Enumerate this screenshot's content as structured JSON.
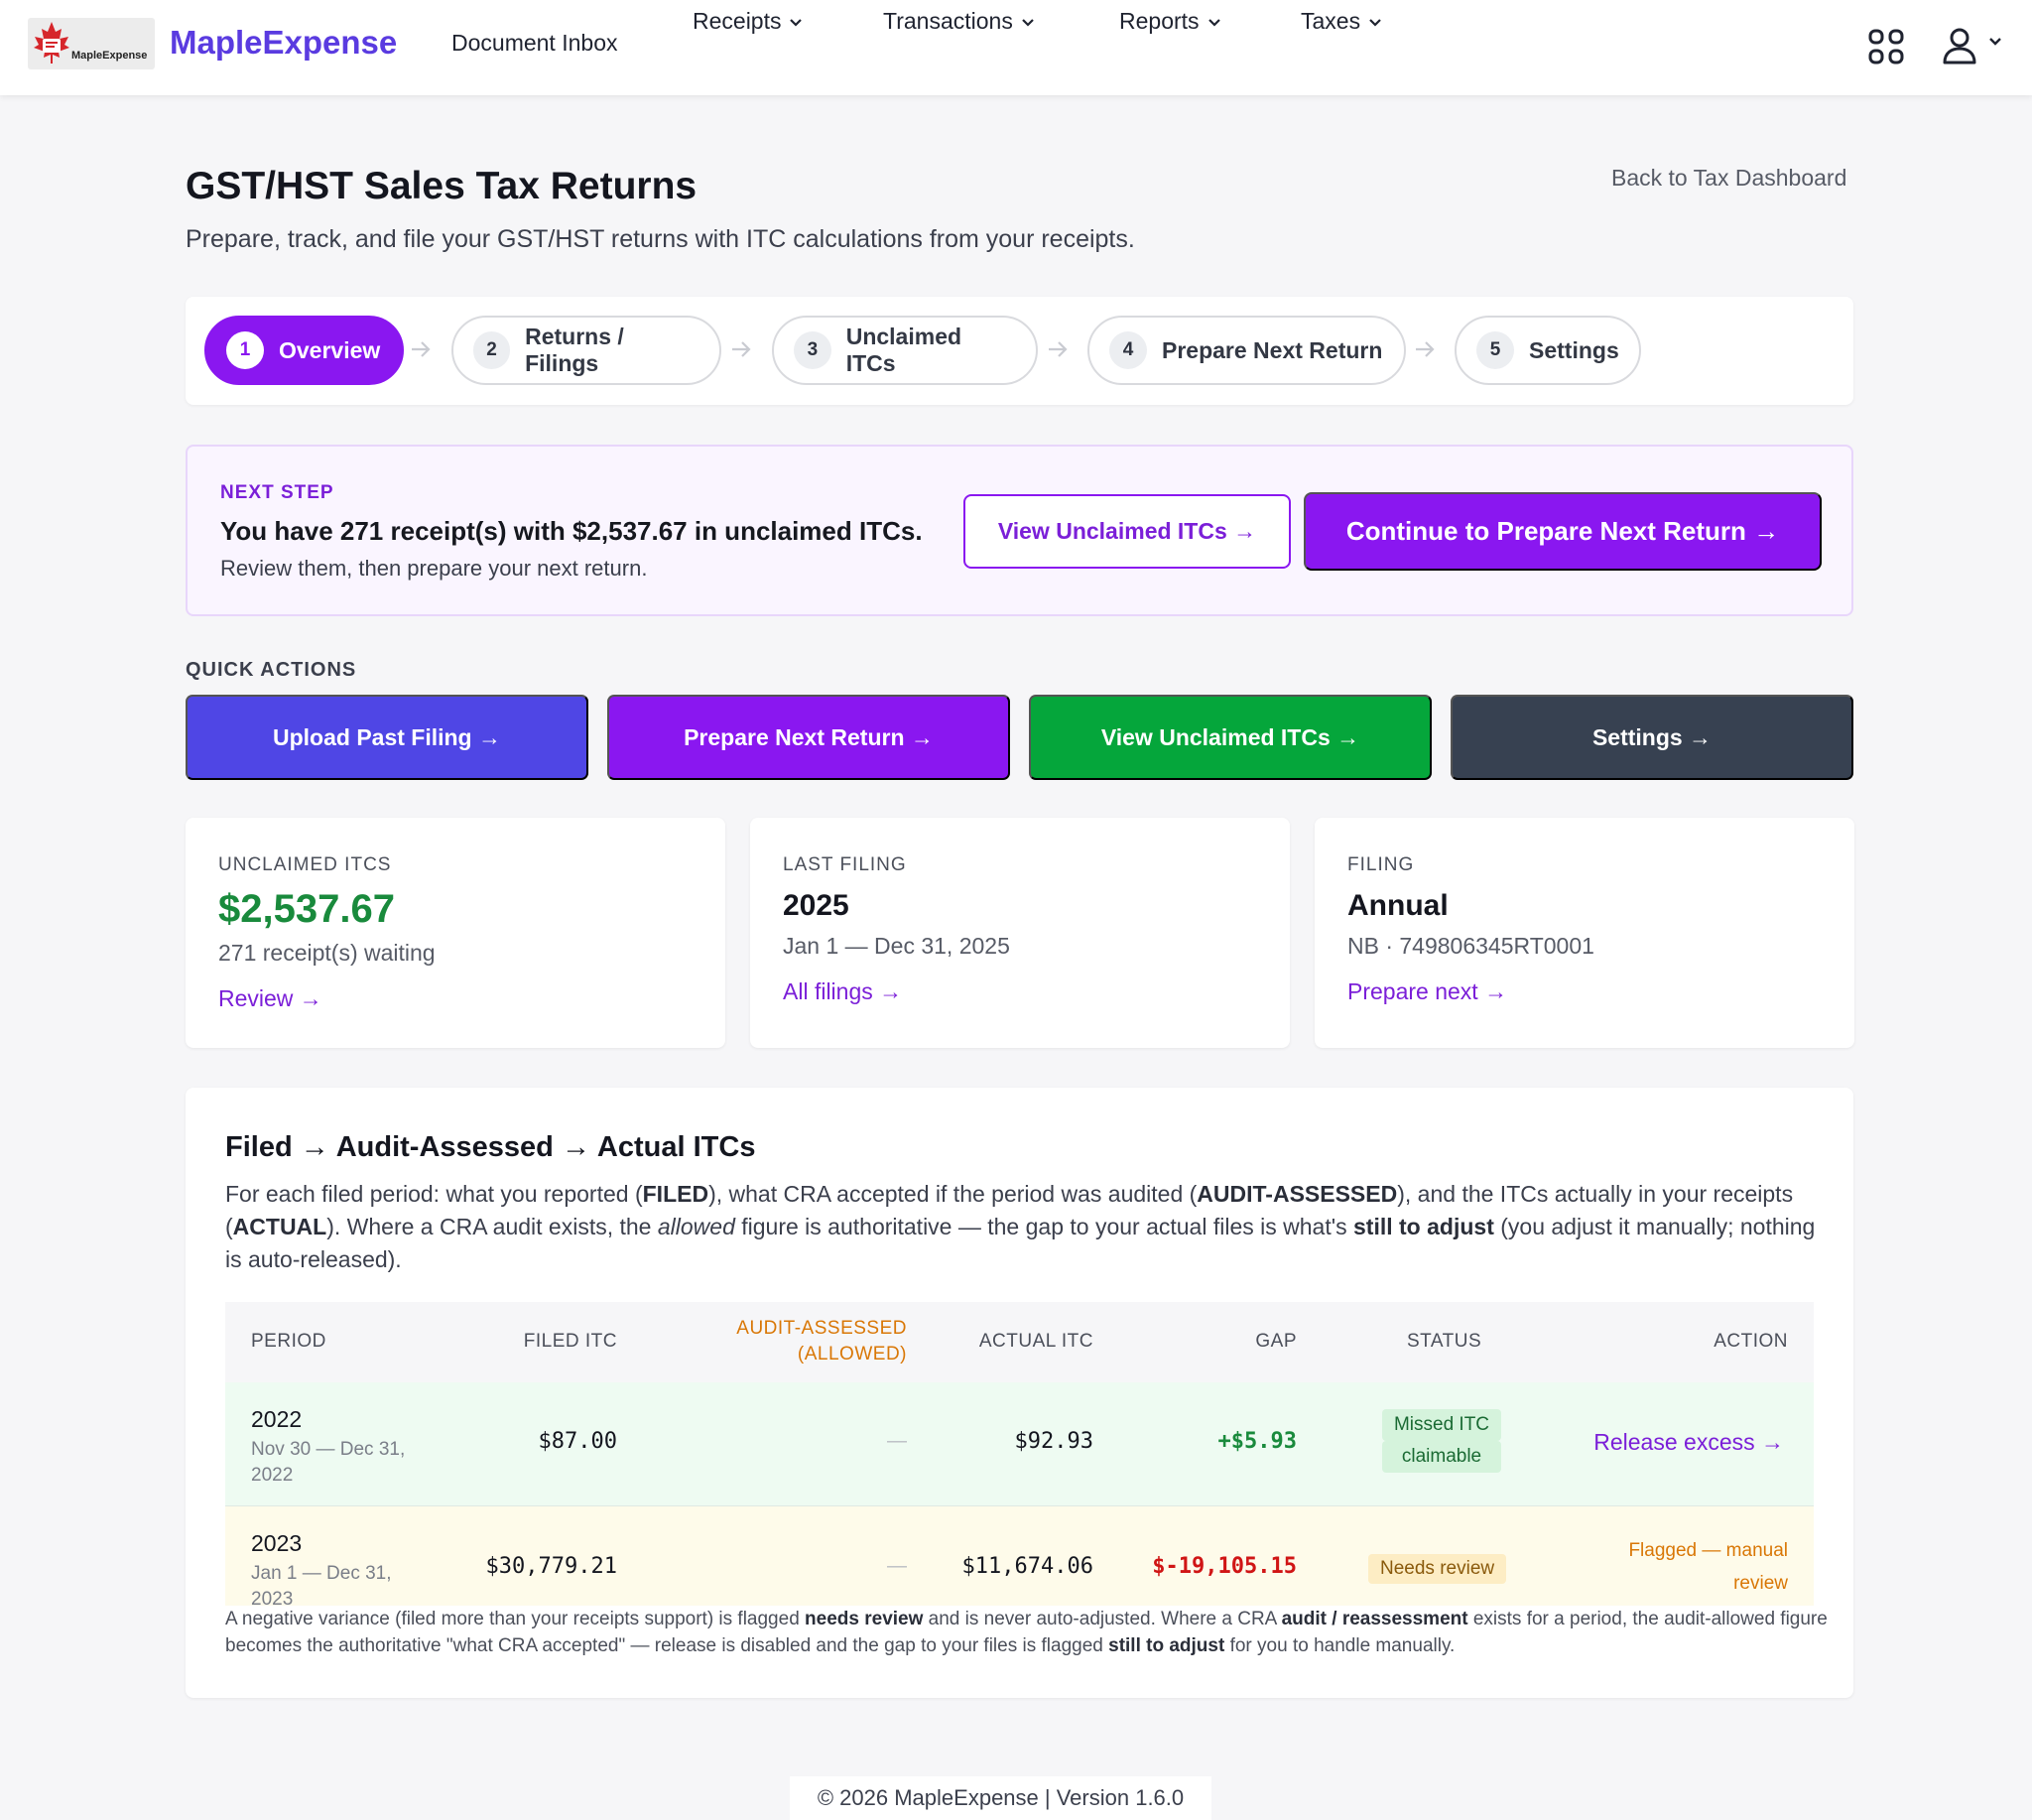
{
  "header": {
    "logo_mini": "MapleExpense",
    "brand": "MapleExpense",
    "nav": {
      "document_inbox": "Document Inbox",
      "receipts": "Receipts",
      "transactions": "Transactions",
      "reports": "Reports",
      "taxes": "Taxes"
    },
    "icons": [
      "maple-leaf-logo-icon",
      "apps-grid-icon",
      "user-icon",
      "chevron-down-icon"
    ]
  },
  "page": {
    "title": "GST/HST Sales Tax Returns",
    "subtitle": "Prepare, track, and file your GST/HST returns with ITC calculations from your receipts.",
    "back_link": "Back to Tax Dashboard"
  },
  "stepper": [
    {
      "num": "1",
      "label": "Overview",
      "active": true
    },
    {
      "num": "2",
      "label": "Returns / Filings",
      "active": false
    },
    {
      "num": "3",
      "label": "Unclaimed ITCs",
      "active": false
    },
    {
      "num": "4",
      "label": "Prepare Next Return",
      "active": false
    },
    {
      "num": "5",
      "label": "Settings",
      "active": false
    }
  ],
  "next_step": {
    "eyebrow": "NEXT STEP",
    "message": "You have 271 receipt(s) with $2,537.67 in unclaimed ITCs.",
    "sub": "Review them, then prepare your next return.",
    "btn_outline": "View Unclaimed ITCs →",
    "btn_solid": "Continue to Prepare Next Return →"
  },
  "quick_actions": {
    "label": "QUICK ACTIONS",
    "buttons": [
      {
        "label": "Upload Past Filing →",
        "color": "#4f46e5"
      },
      {
        "label": "Prepare Next Return →",
        "color": "#8a17f0"
      },
      {
        "label": "View Unclaimed ITCs →",
        "color": "#05a63b"
      },
      {
        "label": "Settings →",
        "color": "#374151"
      }
    ]
  },
  "cards": [
    {
      "label": "UNCLAIMED ITCS",
      "value": "$2,537.67",
      "sub": "271 receipt(s) waiting",
      "link": "Review →"
    },
    {
      "label": "LAST FILING",
      "value": "2025",
      "sub": "Jan 1 — Dec 31, 2025",
      "link": "All filings →"
    },
    {
      "label": "FILING",
      "value": "Annual",
      "sub": "NB · 749806345RT0001",
      "link": "Prepare next →"
    }
  ],
  "itc_section": {
    "title": "Filed → Audit-Assessed → Actual ITCs",
    "desc_parts": [
      "For each filed period: what you reported (",
      "FILED",
      "), what CRA accepted if the period was audited (",
      "AUDIT-ASSESSED",
      "), and the ITCs actually in your receipts (",
      "ACTUAL",
      "). Where a CRA audit exists, the ",
      "allowed",
      " figure is authoritative — the gap to your actual files is what's ",
      "still to adjust",
      " (you adjust it manually; nothing is auto-released)."
    ],
    "columns": {
      "period": "PERIOD",
      "filed": "FILED ITC",
      "audit_1": "AUDIT-ASSESSED",
      "audit_2": "(ALLOWED)",
      "actual": "ACTUAL ITC",
      "gap": "GAP",
      "status": "STATUS",
      "action": "ACTION"
    },
    "rows": [
      {
        "year": "2022",
        "range_1": "Nov 30 — Dec 31,",
        "range_2": "2022",
        "filed": "$87.00",
        "audit": "—",
        "actual": "$92.93",
        "gap": "+$5.93",
        "status_1": "Missed ITC",
        "status_2": "claimable",
        "action": "Release excess →"
      },
      {
        "year": "2023",
        "range_1": "Jan 1 — Dec 31,",
        "range_2": "2023",
        "filed": "$30,779.21",
        "audit": "—",
        "actual": "$11,674.06",
        "gap": "$-19,105.15",
        "status": "Needs review",
        "action_1": "Flagged — manual",
        "action_2": "review"
      }
    ],
    "footnote_parts": [
      "A negative variance (filed more than your receipts support) is flagged ",
      "needs review",
      " and is never auto-adjusted. Where a CRA ",
      "audit / reassessment",
      " exists for a period, the audit-allowed figure becomes the authoritative \"what CRA accepted\" — release is disabled and the gap to your files is flagged ",
      "still to adjust",
      " for you to handle manually."
    ]
  },
  "footer": {
    "text": "© 2026 MapleExpense | Version 1.6.0"
  }
}
